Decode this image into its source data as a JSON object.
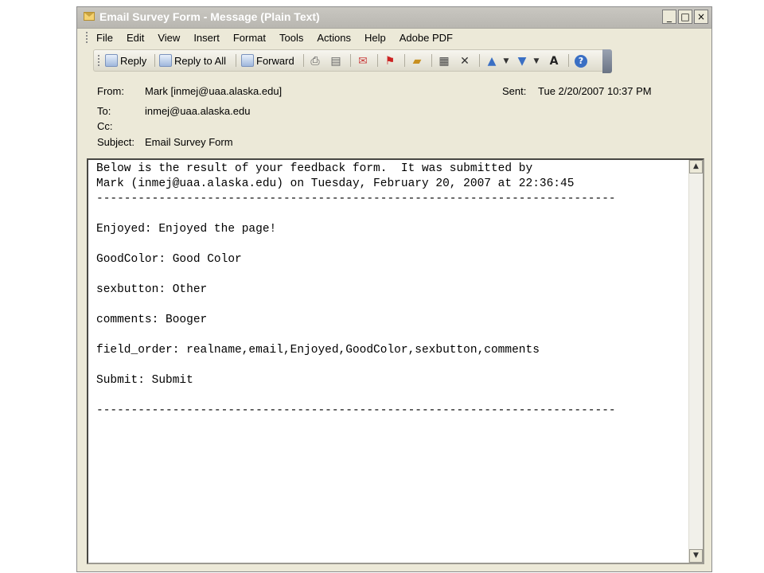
{
  "window": {
    "title": "Email Survey Form - Message (Plain Text)",
    "controls": [
      "_",
      "□",
      "×"
    ]
  },
  "menu": [
    "File",
    "Edit",
    "View",
    "Insert",
    "Format",
    "Tools",
    "Actions",
    "Help",
    "Adobe PDF"
  ],
  "toolbar": {
    "reply": "Reply",
    "reply_all": "Reply to All",
    "forward": "Forward"
  },
  "header": {
    "from_label": "From:",
    "from_value": "Mark [inmej@uaa.alaska.edu]",
    "sent_label": "Sent:",
    "sent_value": "Tue 2/20/2007 10:37 PM",
    "to_label": "To:",
    "to_value": "inmej@uaa.alaska.edu",
    "cc_label": "Cc:",
    "cc_value": "",
    "subject_label": "Subject:",
    "subject_value": "Email Survey Form"
  },
  "body_lines": [
    "Below is the result of your feedback form.  It was submitted by",
    "Mark (inmej@uaa.alaska.edu) on Tuesday, February 20, 2007 at 22:36:45",
    "---------------------------------------------------------------------------",
    "",
    "Enjoyed: Enjoyed the page!",
    "",
    "GoodColor: Good Color",
    "",
    "sexbutton: Other",
    "",
    "comments: Booger",
    "",
    "field_order: realname,email,Enjoyed,GoodColor,sexbutton,comments",
    "",
    "Submit: Submit",
    "",
    "---------------------------------------------------------------------------"
  ],
  "icons": {
    "title": "envelope-icon",
    "reply": "reply-icon",
    "reply_all": "reply-all-icon",
    "forward": "forward-icon"
  }
}
